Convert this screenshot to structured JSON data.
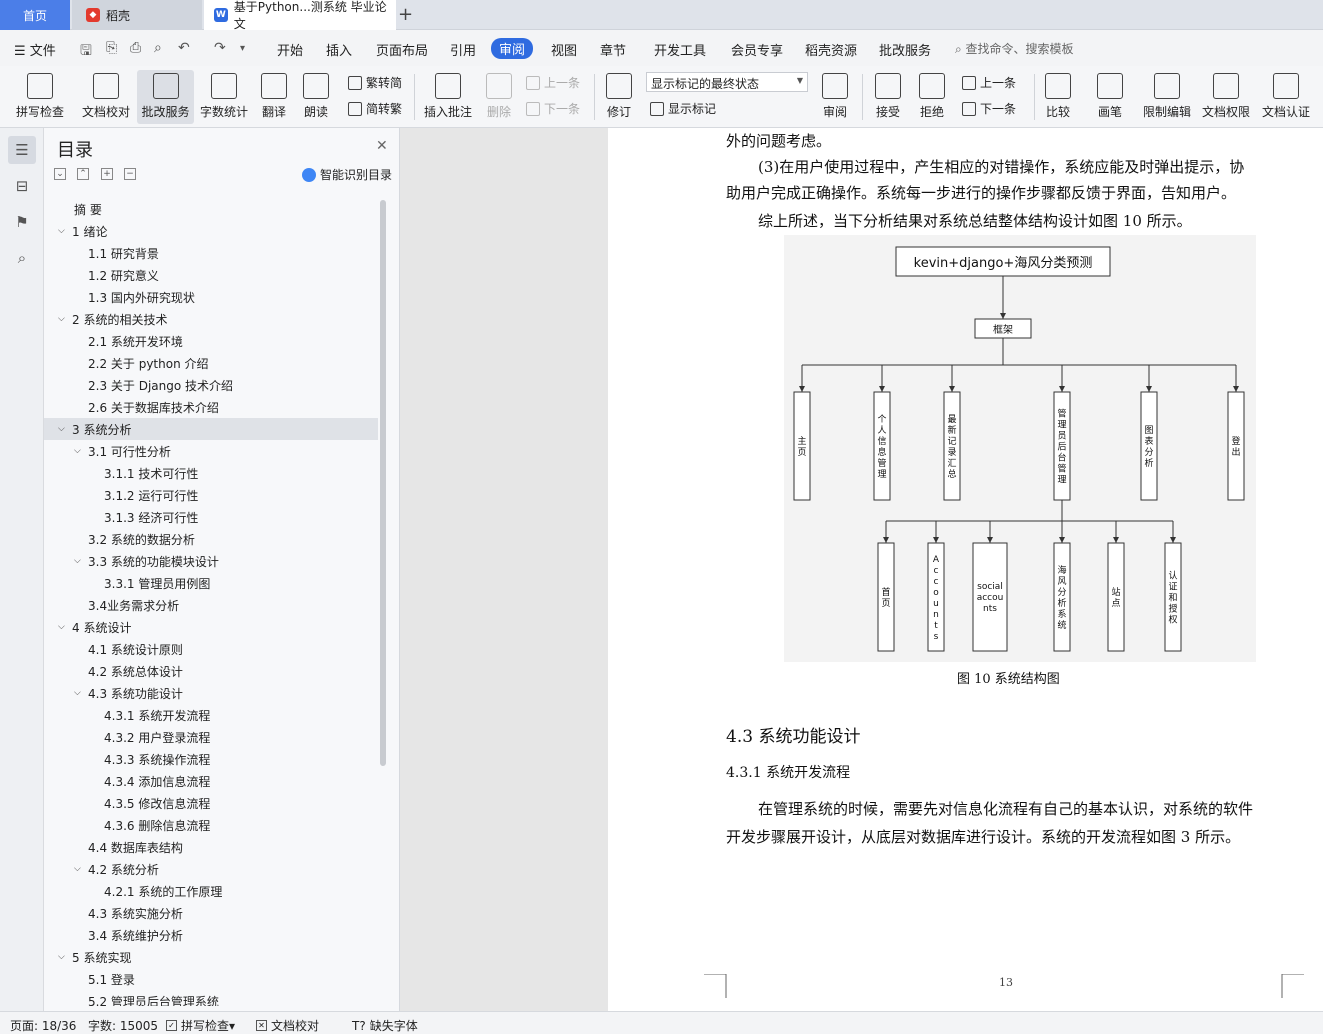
{
  "tabs": {
    "home": "首页",
    "daoke": "稻壳",
    "doc": "基于Python...测系统 毕业论文"
  },
  "menu": {
    "file": "文件",
    "items": [
      "开始",
      "插入",
      "页面布局",
      "引用",
      "审阅",
      "视图",
      "章节",
      "开发工具",
      "会员专享",
      "稻壳资源",
      "批改服务"
    ],
    "active": "审阅",
    "search": "查找命令、搜索模板"
  },
  "ribbon": {
    "spell": "拼写检查",
    "proof": "文档校对",
    "review_service": "批改服务",
    "word_count": "字数统计",
    "translate": "翻译",
    "read_aloud": "朗读",
    "to_simplified": "繁转简",
    "to_traditional": "简转繁",
    "insert_comment": "插入批注",
    "delete": "删除",
    "prev": "上一条",
    "next": "下一条",
    "track": "修订",
    "markup_state": "显示标记的最终状态",
    "show_markup": "显示标记",
    "review": "审阅",
    "accept": "接受",
    "reject": "拒绝",
    "prev2": "上一条",
    "next2": "下一条",
    "compare": "比较",
    "pen": "画笔",
    "restrict": "限制编辑",
    "permission": "文档权限",
    "certify": "文档认证"
  },
  "toc": {
    "title": "目录",
    "smart": "智能识别目录",
    "items": [
      {
        "label": "摘    要",
        "level": 0,
        "caret": ""
      },
      {
        "label": "1  绪论",
        "level": 0,
        "caret": "v"
      },
      {
        "label": "1.1  研究背景",
        "level": 1,
        "caret": ""
      },
      {
        "label": "1.2  研究意义",
        "level": 1,
        "caret": ""
      },
      {
        "label": "1.3  国内外研究现状",
        "level": 1,
        "caret": ""
      },
      {
        "label": "2  系统的相关技术",
        "level": 0,
        "caret": "v"
      },
      {
        "label": "2.1  系统开发环境",
        "level": 1,
        "caret": ""
      },
      {
        "label": "2.2    关于 python 介绍",
        "level": 1,
        "caret": ""
      },
      {
        "label": "2.3  关于 Django 技术介绍",
        "level": 1,
        "caret": ""
      },
      {
        "label": "2.6  关于数据库技术介绍",
        "level": 1,
        "caret": ""
      },
      {
        "label": "3  系统分析",
        "level": 0,
        "caret": "v",
        "selected": true
      },
      {
        "label": "3.1  可行性分析",
        "level": 1,
        "caret": "v"
      },
      {
        "label": "3.1.1  技术可行性",
        "level": 2,
        "caret": ""
      },
      {
        "label": "3.1.2  运行可行性",
        "level": 2,
        "caret": ""
      },
      {
        "label": "3.1.3  经济可行性",
        "level": 2,
        "caret": ""
      },
      {
        "label": "3.2  系统的数据分析",
        "level": 1,
        "caret": ""
      },
      {
        "label": "3.3  系统的功能模块设计",
        "level": 1,
        "caret": "v"
      },
      {
        "label": "3.3.1 管理员用例图",
        "level": 2,
        "caret": ""
      },
      {
        "label": "3.4业务需求分析",
        "level": 1,
        "caret": ""
      },
      {
        "label": "4  系统设计",
        "level": 0,
        "caret": "v"
      },
      {
        "label": "4.1  系统设计原则",
        "level": 1,
        "caret": ""
      },
      {
        "label": "4.2  系统总体设计",
        "level": 1,
        "caret": ""
      },
      {
        "label": "4.3  系统功能设计",
        "level": 1,
        "caret": "v"
      },
      {
        "label": "4.3.1  系统开发流程",
        "level": 2,
        "caret": ""
      },
      {
        "label": "4.3.2  用户登录流程",
        "level": 2,
        "caret": ""
      },
      {
        "label": "4.3.3  系统操作流程",
        "level": 2,
        "caret": ""
      },
      {
        "label": "4.3.4  添加信息流程",
        "level": 2,
        "caret": ""
      },
      {
        "label": "4.3.5  修改信息流程",
        "level": 2,
        "caret": ""
      },
      {
        "label": "4.3.6  删除信息流程",
        "level": 2,
        "caret": ""
      },
      {
        "label": "4.4 数据库表结构",
        "level": 1,
        "caret": ""
      },
      {
        "label": "4.2  系统分析",
        "level": 1,
        "caret": "v"
      },
      {
        "label": "4.2.1  系统的工作原理",
        "level": 2,
        "caret": ""
      },
      {
        "label": "4.3    系统实施分析",
        "level": 1,
        "caret": ""
      },
      {
        "label": "3.4    系统维护分析",
        "level": 1,
        "caret": ""
      },
      {
        "label": "5  系统实现",
        "level": 0,
        "caret": "v"
      },
      {
        "label": "5.1 登录",
        "level": 1,
        "caret": ""
      },
      {
        "label": "5.2 管理员后台管理系统",
        "level": 1,
        "caret": ""
      }
    ]
  },
  "doc": {
    "line0": "外的问题考虑。",
    "line1": "(3)在用户使用过程中，产生相应的对错操作，系统应能及时弹出提示，协",
    "line2": "助用户完成正确操作。系统每一步进行的操作步骤都反馈于界面，告知用户。",
    "line3": "综上所述，当下分析结果对系统总结整体结构设计如图 10 所示。",
    "diagram": {
      "root": "kevin+django+海风分类预测",
      "frame": "框架",
      "level1": [
        "主页",
        "个人信息管理",
        "最新记录汇总",
        "管理员后台管理",
        "图表分析",
        "登出"
      ],
      "level2": [
        "首页",
        "Accounts",
        "social accounts",
        "海风分析系统",
        "站点",
        "认证和授权"
      ]
    },
    "caption": "图 10  系统结构图",
    "h2": "4.3  系统功能设计",
    "h3": "4.3.1  系统开发流程",
    "para1": "在管理系统的时候，需要先对信息化流程有自己的基本认识，对系统的软件",
    "para2": "开发步骤展开设计，从底层对数据库进行设计。系统的开发流程如图 3 所示。",
    "page_number": "13"
  },
  "status": {
    "page": "页面: 18/36",
    "words": "字数: 15005",
    "spell": "拼写检查",
    "proof": "文档校对",
    "missing_font": "缺失字体"
  }
}
